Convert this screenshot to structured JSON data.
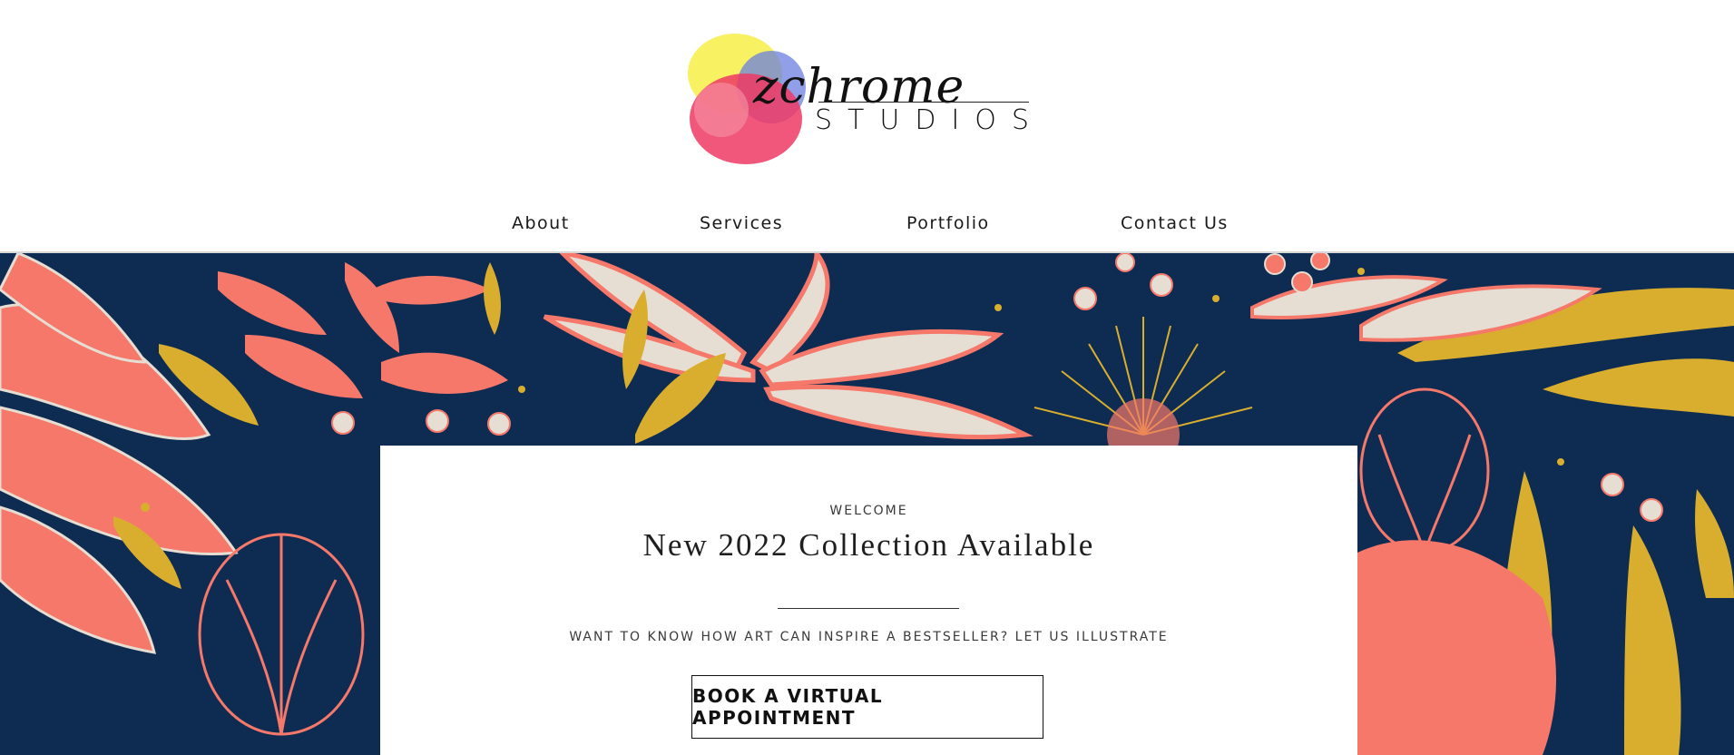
{
  "brand": {
    "script_name": "zchrome",
    "subtitle": "STUDIOS"
  },
  "nav": {
    "items": [
      {
        "label": "About"
      },
      {
        "label": "Services"
      },
      {
        "label": "Portfolio"
      },
      {
        "label": "Contact Us"
      }
    ]
  },
  "hero": {
    "eyebrow": "WELCOME",
    "title": "New 2022 Collection Available",
    "subtitle": "WANT TO KNOW HOW ART CAN INSPIRE A BESTSELLER? LET US ILLUSTRATE",
    "cta_label": "BOOK A VIRTUAL APPOINTMENT"
  },
  "colors": {
    "navy": "#0e2c52",
    "coral": "#f5786a",
    "mustard": "#d9ae2f",
    "cream": "#e6ddd3",
    "text": "#1f1f1f"
  }
}
